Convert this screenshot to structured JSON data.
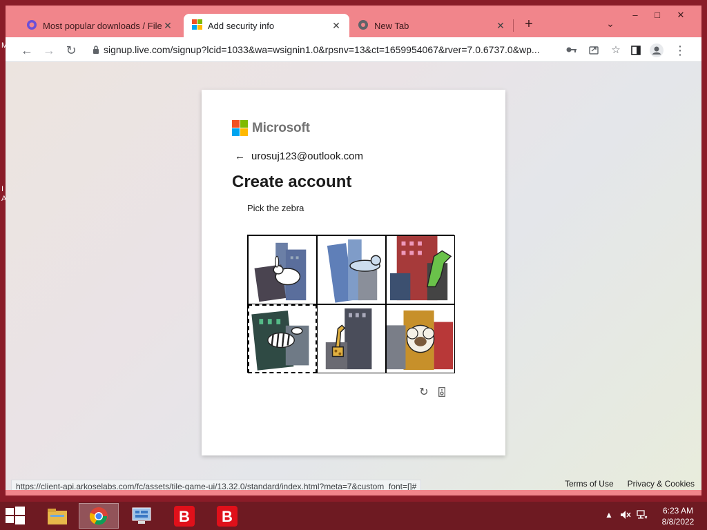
{
  "desktop": {
    "left_letters": [
      "M",
      "I",
      "A"
    ]
  },
  "browser": {
    "tabs": [
      {
        "title": "Most popular downloads / FileH",
        "icon": "filehorse-icon",
        "active": false
      },
      {
        "title": "Add security info",
        "icon": "microsoft-icon",
        "active": true
      },
      {
        "title": "New Tab",
        "icon": "chrome-icon",
        "active": false
      }
    ],
    "new_tab_label": "+",
    "tab_search_label": "⌄",
    "window_controls": {
      "minimize": "–",
      "maximize": "□",
      "close": "✕"
    },
    "toolbar": {
      "back": "←",
      "forward": "→",
      "reload": "↻",
      "url": "signup.live.com/signup?lcid=1033&wa=wsignin1.0&rpsnv=13&ct=1659954067&rver=7.0.6737.0&wp..."
    },
    "status_url": "https://client-api.arkoselabs.com/fc/assets/tile-game-ui/13.32.0/standard/index.html?meta=7&custom_font=[]#"
  },
  "page": {
    "brand": "Microsoft",
    "brand_colors": [
      "#f25022",
      "#7fba00",
      "#00a4ef",
      "#ffb900"
    ],
    "back_arrow": "←",
    "email": "urosuj123@outlook.com",
    "heading": "Create account",
    "prompt": "Pick the zebra",
    "tiles": [
      {
        "animal": "rabbit",
        "selected": false
      },
      {
        "animal": "seal",
        "selected": false
      },
      {
        "animal": "dinosaur",
        "selected": false
      },
      {
        "animal": "zebra",
        "selected": true
      },
      {
        "animal": "giraffe",
        "selected": false
      },
      {
        "animal": "sheep",
        "selected": false
      }
    ],
    "reload_icon": "↻",
    "audio_icon": "▯",
    "footer": {
      "terms": "Terms of Use",
      "privacy": "Privacy & Cookies"
    }
  },
  "taskbar": {
    "apps": [
      "file-explorer-icon",
      "chrome-icon",
      "control-panel-icon",
      "bitdefender-icon",
      "bitdefender-icon"
    ],
    "time": "6:23 AM",
    "date": "8/8/2022"
  }
}
